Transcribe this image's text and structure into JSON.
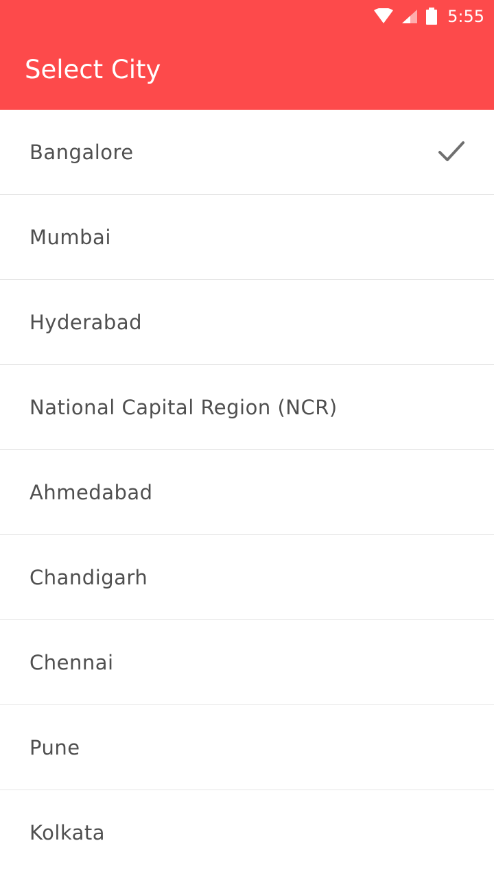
{
  "status_bar": {
    "time": "5:55",
    "icons": [
      "wifi-icon",
      "signal-icon",
      "battery-icon"
    ]
  },
  "header": {
    "title": "Select City",
    "background_color": "#fd4a4b"
  },
  "cities": [
    {
      "label": "Bangalore",
      "selected": true
    },
    {
      "label": "Mumbai",
      "selected": false
    },
    {
      "label": "Hyderabad",
      "selected": false
    },
    {
      "label": "National Capital Region (NCR)",
      "selected": false
    },
    {
      "label": "Ahmedabad",
      "selected": false
    },
    {
      "label": "Chandigarh",
      "selected": false
    },
    {
      "label": "Chennai",
      "selected": false
    },
    {
      "label": "Pune",
      "selected": false
    },
    {
      "label": "Kolkata",
      "selected": false
    }
  ],
  "selected_indicator_icon": "check-icon"
}
